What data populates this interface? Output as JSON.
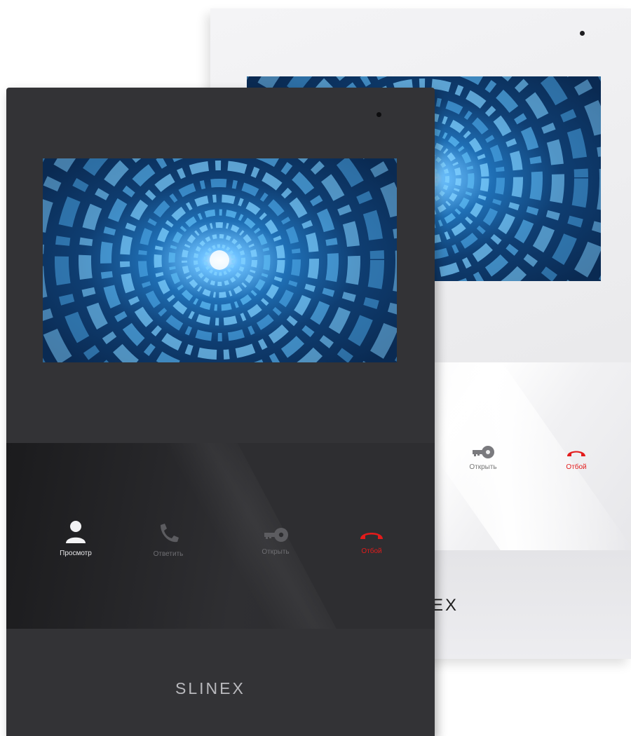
{
  "brand": "SLINEX",
  "white_device": {
    "brand_visible": "EX",
    "buttons": [
      {
        "label": "Открыть",
        "icon": "key-icon"
      },
      {
        "label": "Отбой",
        "icon": "hangup-icon"
      }
    ]
  },
  "black_device": {
    "brand": "SLINEX",
    "buttons": [
      {
        "label": "Просмотр",
        "icon": "person-icon"
      },
      {
        "label": "Ответить",
        "icon": "phone-icon"
      },
      {
        "label": "Открыть",
        "icon": "key-icon"
      },
      {
        "label": "Отбой",
        "icon": "hangup-icon"
      }
    ]
  },
  "colors": {
    "hangup_red": "#e31b1b",
    "screen_blue": "#2f8fd6",
    "black_body": "#333336",
    "white_body": "#efeff1"
  }
}
